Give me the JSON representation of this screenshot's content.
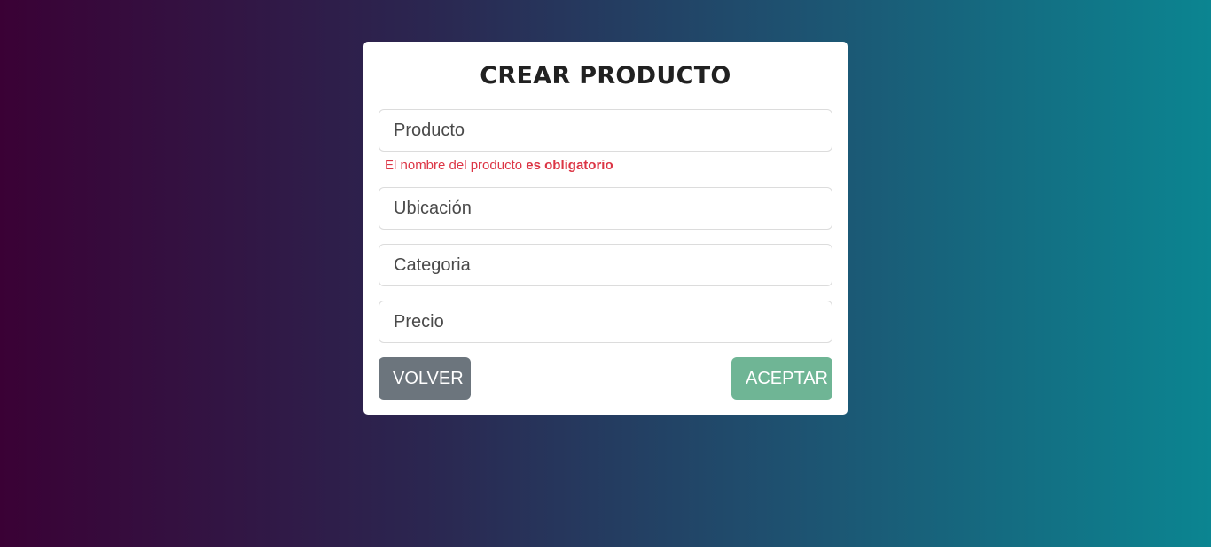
{
  "form": {
    "title": "CREAR PRODUCTO",
    "fields": {
      "producto": {
        "placeholder": "Producto",
        "value": ""
      },
      "ubicacion": {
        "placeholder": "Ubicación",
        "value": ""
      },
      "categoria": {
        "placeholder": "Categoria",
        "value": ""
      },
      "precio": {
        "placeholder": "Precio",
        "value": ""
      }
    },
    "error": {
      "text": "El nombre del producto ",
      "emphasis": "es obligatorio",
      "color": "#dc3545"
    },
    "buttons": {
      "back_label": "VOLVER",
      "accept_label": "ACEPTAR"
    }
  },
  "colors": {
    "gradient_start": "#3a0135",
    "gradient_end": "#0b8591",
    "back_button": "#6c757d",
    "accept_button": "#6fb595"
  }
}
